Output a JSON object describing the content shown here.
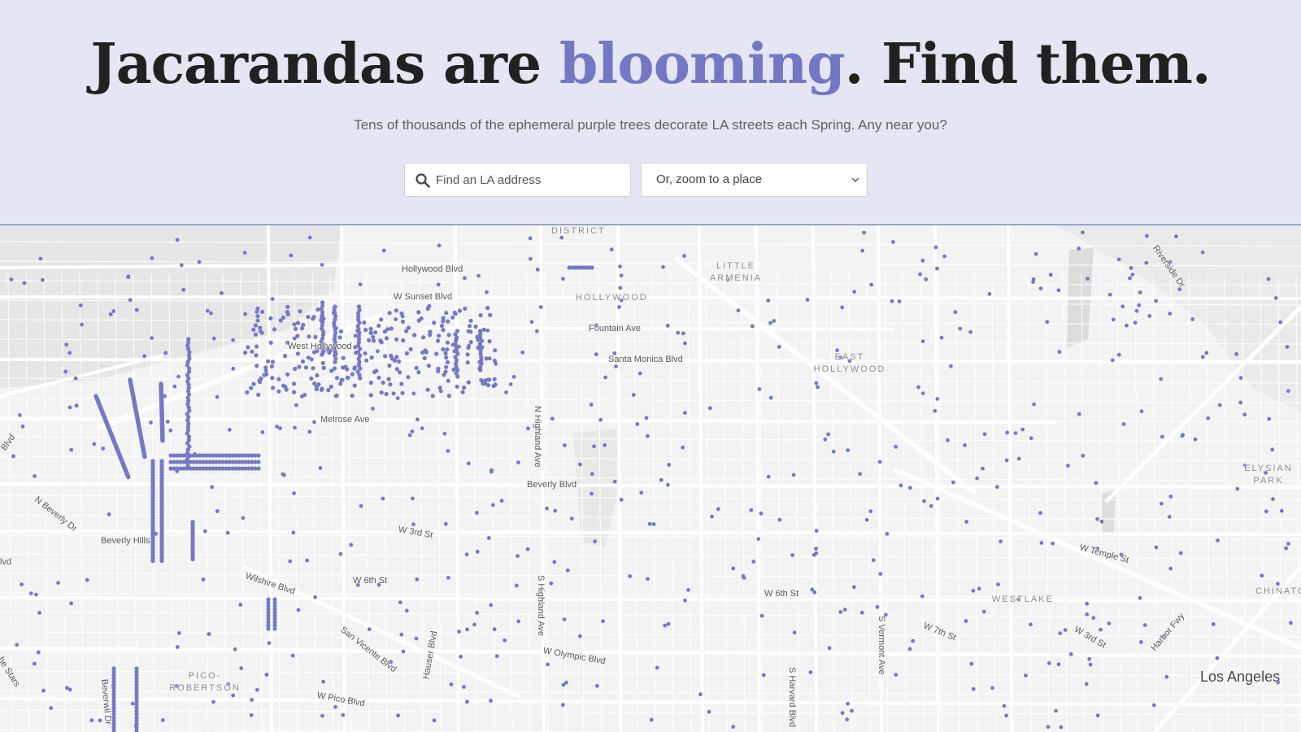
{
  "header": {
    "title_before": "Jacarandas are ",
    "title_accent": "blooming",
    "title_after": ". Find them.",
    "subtitle": "Tens of thousands of the ephemeral purple trees decorate LA streets each Spring. Any near you?"
  },
  "search": {
    "placeholder": "Find an LA address",
    "icon": "search-icon"
  },
  "place_select": {
    "selected": "Or, zoom to a place",
    "icon": "chevron-down-icon"
  },
  "colors": {
    "header_bg": "#e4e6f3",
    "accent": "#7378c4",
    "tree_dot": "#7479c6",
    "map_bg": "#f3f3f3",
    "road": "#ffffff"
  },
  "map": {
    "street_labels": {
      "hollywood_blvd": "Hollywood Blvd",
      "sunset_blvd": "W Sunset Blvd",
      "fountain_ave": "Fountain Ave",
      "santa_monica_blvd": "Santa Monica Blvd",
      "melrose_ave": "Melrose Ave",
      "n_highland_ave": "N Highland Ave",
      "beverly_blvd": "Beverly Blvd",
      "w_3rd_st": "W 3rd St",
      "n_beverly_dr": "N Beverly Dr",
      "wilshire_blvd": "Wilshire Blvd",
      "w_6th_st_west": "W 6th St",
      "s_highland_ave": "S Highland Ave",
      "w_6th_st_east": "W 6th St",
      "san_vicente_blvd": "San Vicente Blvd",
      "hauser_blvd": "Hauser Blvd",
      "w_olympic_blvd": "W Olympic Blvd",
      "w_pico_blvd": "W Pico Blvd",
      "s_harvard_blvd": "S Harvard Blvd",
      "s_vermont_ave": "S Vermont Ave",
      "w_7th_st": "W 7th St",
      "w_3rd_st_east": "W 3rd St",
      "harbor_fwy": "Harbor Fwy",
      "w_temple_st": "W Temple St",
      "riverside_dr": "Riverside Dr",
      "beverwil": "Beverwil Dr",
      "blvd_left": "Blvd",
      "lvd_left": "lvd",
      "stars_left": "he Stars"
    },
    "place_labels": {
      "west_hollywood": "West Hollywood",
      "beverly_hills": "Beverly Hills",
      "los_angeles": "Los Angeles",
      "district": "DISTRICT",
      "hollywood": "HOLLYWOOD",
      "little_armenia": "LITTLE ARMENIA",
      "east_hollywood": "EAST HOLLYWOOD",
      "elysian_park": "ELYSIAN PARK",
      "westlake": "WESTLAKE",
      "chinatown": "CHINATO",
      "pico_robertson": "PICO-ROBERTSON"
    }
  }
}
